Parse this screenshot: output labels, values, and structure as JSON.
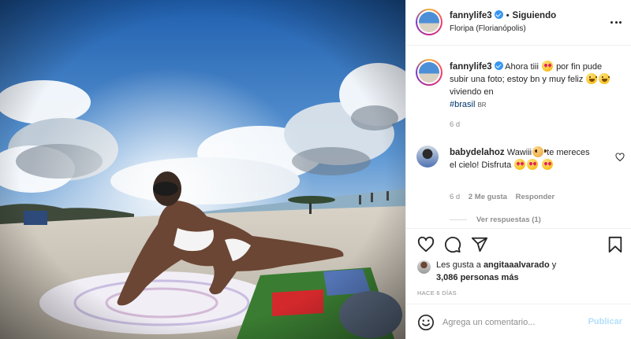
{
  "post": {
    "username": "fannylife3",
    "verified": true,
    "separator": "•",
    "follow_status": "Siguiendo",
    "location": "Floripa (Florianópolis)",
    "more_icon": "ellipsis-icon",
    "photo_alt": "Mujer en bikini blanco recostada sobre un pareo en la playa"
  },
  "caption": {
    "username": "fannylife3",
    "text_1": "Ahora tiii",
    "text_2": "por fin pude subir una foto; estoy bn y muy feliz",
    "text_3": "viviendo en",
    "hashtag": "#brasil",
    "flag": "BR",
    "time": "6 d"
  },
  "comment": {
    "username": "babydelahoz",
    "text_1": "Wawiii",
    "text_2": "te mereces el cielo! Disfruta",
    "time": "6 d",
    "likes": "2 Me gusta",
    "reply": "Responder",
    "view_replies": "Ver respuestas (1)"
  },
  "actions": {
    "like_icon": "heart-icon",
    "comment_icon": "comment-icon",
    "share_icon": "send-icon",
    "save_icon": "bookmark-icon"
  },
  "likes": {
    "prefix": "Les gusta a",
    "user": "angitaaalvarado",
    "suffix": "y",
    "count": "3,086 personas más"
  },
  "date": "HACE 6 DÍAS",
  "composer": {
    "placeholder": "Agrega un comentario...",
    "publish": "Publicar",
    "emoji_icon": "smiley-icon"
  },
  "colors": {
    "accent": "#3897f0",
    "publish_disabled": "#b2dffc",
    "muted": "#8e8e8e",
    "border": "#efefef"
  }
}
